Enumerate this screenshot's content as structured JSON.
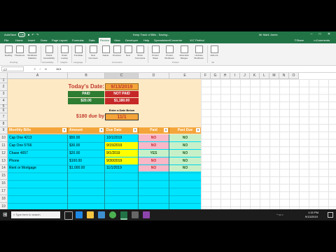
{
  "app": {
    "autosave": "AutoSave",
    "autosave_state": "Off",
    "window_title": "Keep Track of Bills - Saving...",
    "user": "Mr Mark Jones",
    "min": "–",
    "max": "□",
    "close": "✕"
  },
  "menu": [
    "File",
    "Home",
    "Insert",
    "Draw",
    "Page Layout",
    "Formulas",
    "Data",
    "Review",
    "View",
    "Developer",
    "Help",
    "SpreadsheetConverter",
    "XLT Perfect"
  ],
  "menu_active": "Review",
  "menu_right": {
    "share": "Share",
    "comments": "Comments"
  },
  "ribbon": {
    "buttons": [
      "Spelling",
      "Thesaurus",
      "Workbook Statistics",
      "Check Accessibility",
      "Smart Lookup",
      "Translate",
      "New Comment",
      "Delete",
      "Previous",
      "Next",
      "Show Comments",
      "Protect Sheet",
      "Protect Workbook",
      "Allow Edit Ranges",
      "Unshare Workbook",
      "Hide Ink"
    ],
    "groups": [
      "Proofing",
      "Accessibility",
      "Insights",
      "Language",
      "Comments",
      "Protect",
      "Ink"
    ]
  },
  "formula_bar": {
    "name_box": "C7",
    "fx": "fx",
    "value": "11/1"
  },
  "columns": [
    "A",
    "B",
    "C",
    "D",
    "E",
    "F",
    "G",
    "H",
    "I",
    "J",
    "K",
    "L",
    "M",
    "N",
    "O"
  ],
  "rows": [
    "1",
    "2",
    "3",
    "4",
    "5",
    "6",
    "7",
    "8",
    "9",
    "10",
    "11",
    "12",
    "13",
    "14",
    "15",
    "16",
    "17",
    "18",
    "19"
  ],
  "sheet": {
    "today_label": "Today's Date:",
    "today_value": "9/13/2019",
    "paid_label": "PAID",
    "paid_value": "$20.00",
    "not_paid_label": "NOT PAID",
    "not_paid_value": "$1,180.00",
    "enter_date_label": "Enter a Date Below",
    "due_by_label": "$180 due by",
    "due_by_value": "11/1"
  },
  "table": {
    "headers": [
      "Monthly Bills",
      "Amount",
      "Due Date",
      "Paid",
      "Past Due"
    ],
    "rows": [
      {
        "bill": "Cap One 4213",
        "amount": "$50.00",
        "due": "10/1/2019",
        "paid": "NO",
        "past_due": "NO"
      },
      {
        "bill": "Cap One 5766",
        "amount": "$30.00",
        "due": "9/15/2019",
        "paid": "NO",
        "past_due": "NO"
      },
      {
        "bill": "Chase 4657",
        "amount": "$20.00",
        "due": "9/1/2019",
        "paid": "YES",
        "past_due": "NO"
      },
      {
        "bill": "Phone",
        "amount": "$100.00",
        "due": "9/30/2019",
        "paid": "NO",
        "past_due": "NO"
      },
      {
        "bill": "Rent or Mortgage",
        "amount": "$1,000.00",
        "due": "11/1/2019",
        "paid": "NO",
        "past_due": "NO"
      }
    ]
  },
  "tabs": {
    "active": "Monthly Bills",
    "other": "Sheet2",
    "add": "+"
  },
  "taskbar": {
    "time": "1:15 PM",
    "date": "9/13/2019",
    "search_placeholder": "Type here to search"
  },
  "colors": {
    "excel_green": "#217346",
    "paid_green": "#2e7d32",
    "not_paid_red": "#c62828",
    "header_orange": "#f4a53a",
    "row_cyan": "#00e5ff",
    "due_yellow": "#ffff00",
    "no_pink": "#f8b8c8",
    "yes_green": "#c8f0c8"
  }
}
